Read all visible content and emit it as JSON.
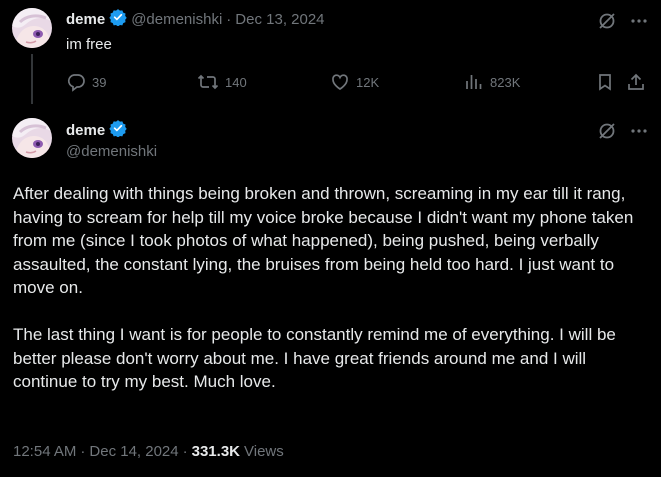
{
  "first_post": {
    "display_name": "deme",
    "handle": "@demenishki",
    "separator": "·",
    "date": "Dec 13, 2024",
    "text": "im free",
    "actions": {
      "replies": "39",
      "reposts": "140",
      "likes": "12K",
      "views": "823K"
    }
  },
  "main_post": {
    "display_name": "deme",
    "handle": "@demenishki",
    "paragraphs": [
      "After dealing with things being broken and thrown, screaming in my ear till it rang, having to scream for help till my voice broke because I didn't want my phone taken from me (since I took photos of what happened), being pushed, being verbally assaulted, the constant lying, the bruises from being held too hard. I just want to move on.",
      "The last thing I want is for people to constantly remind me of everything. I will be better please don't worry about me. I have great friends around me and I will continue to try my best. Much love."
    ],
    "time": "12:54 AM",
    "sep1": "·",
    "date": "Dec 14, 2024",
    "sep2": "·",
    "views_count": "331.3K",
    "views_label": "Views"
  },
  "colors": {
    "background": "#000000",
    "text": "#e7e9ea",
    "secondary": "#71767b",
    "verified": "#1d9bf0"
  },
  "icons": [
    "reply-icon",
    "repost-icon",
    "like-icon",
    "views-icon",
    "bookmark-icon",
    "share-icon",
    "grok-icon",
    "more-icon",
    "verified-badge-icon"
  ]
}
